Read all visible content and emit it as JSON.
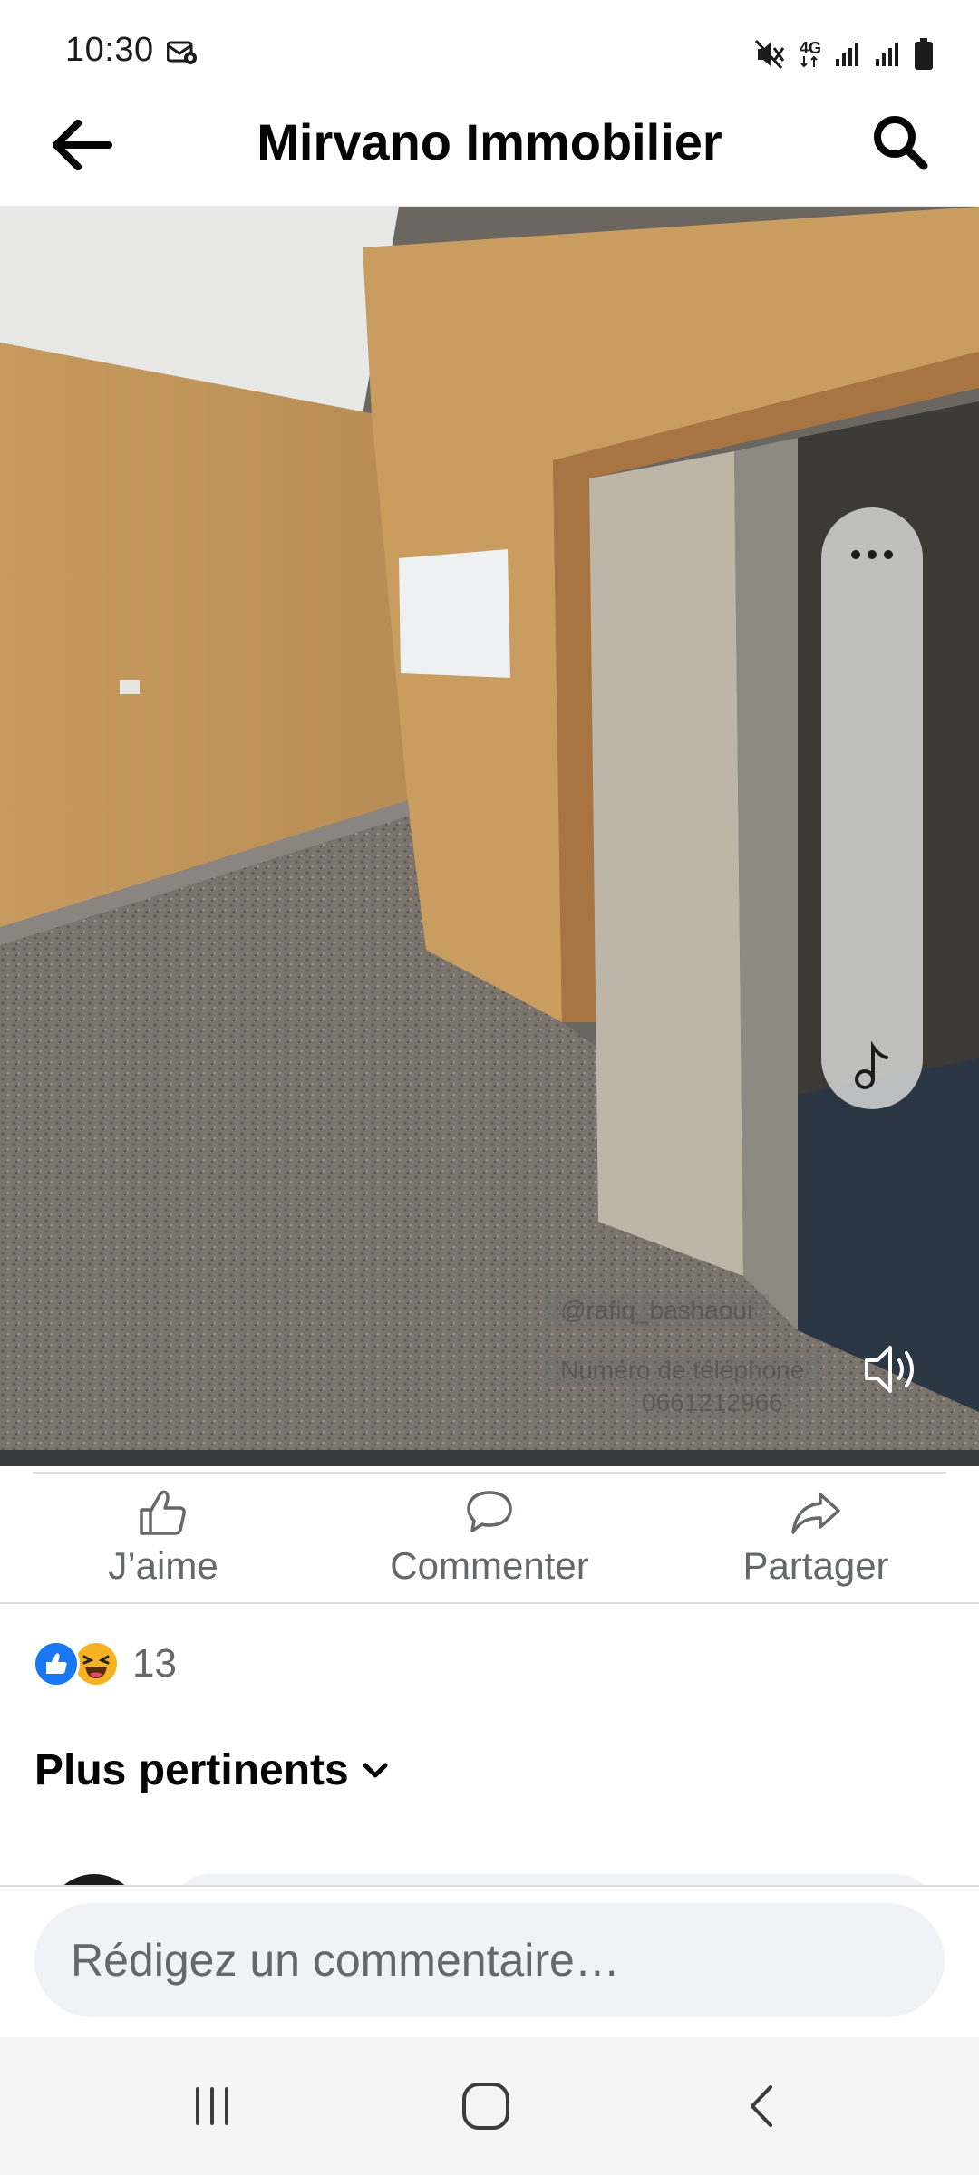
{
  "status_bar": {
    "time": "10:30",
    "network": "4G",
    "icons": [
      "settings-notification-icon",
      "mute-icon",
      "network-4g-icon",
      "signal-icon",
      "signal-icon",
      "battery-icon"
    ]
  },
  "header": {
    "title": "Mirvano Immobilier",
    "back_icon": "arrow-left-icon",
    "search_icon": "search-icon"
  },
  "video": {
    "watermark_lines": [
      "@rafiq_bashaoui",
      "Numéro de téléphone",
      "0661212966"
    ],
    "side_controls": [
      "more-icon",
      "music-note-icon"
    ],
    "sound_icon": "speaker-icon"
  },
  "actions": {
    "like_label": "J’aime",
    "comment_label": "Commenter",
    "share_label": "Partager"
  },
  "reactions": {
    "types": [
      "like",
      "haha"
    ],
    "count": "13"
  },
  "comments": {
    "sort_label": "Plus pertinents"
  },
  "composer": {
    "placeholder": "Rédigez un commentaire…"
  },
  "nav_bar": {
    "icons": [
      "recent-apps-icon",
      "home-icon",
      "back-icon"
    ]
  },
  "colors": {
    "accent": "#1877f2",
    "secondary_text": "#65676b",
    "input_bg": "#f0f2f5",
    "haha": "#f7b125"
  }
}
